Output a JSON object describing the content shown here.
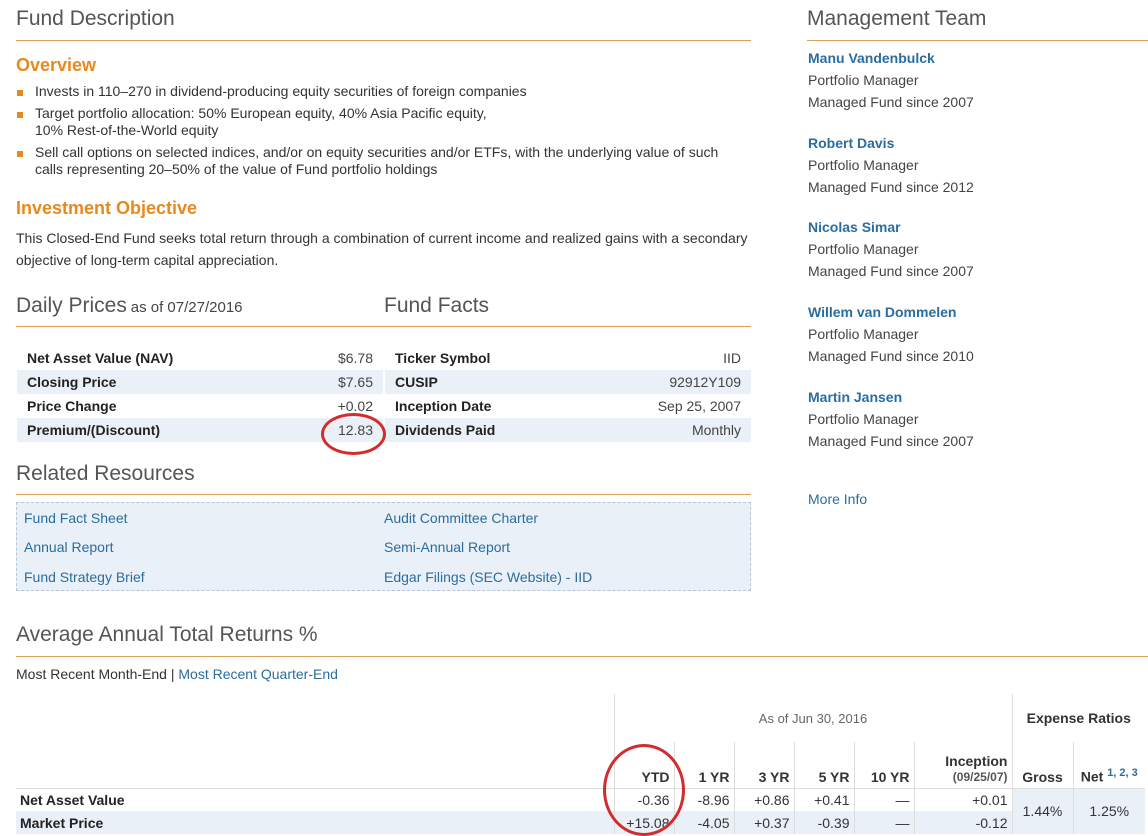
{
  "fund_description": {
    "title": "Fund Description",
    "overview_title": "Overview",
    "bullets": [
      {
        "line1": "Invests in 110–270 in dividend-producing equity securities of foreign companies",
        "line2": ""
      },
      {
        "line1": "Target portfolio allocation: 50% European equity, 40% Asia Pacific equity,",
        "line2": "10% Rest-of-the-World equity"
      },
      {
        "line1": "Sell call options on selected indices, and/or on equity securities and/or ETFs, with the underlying value of such",
        "line2": "calls representing 20–50% of the value of Fund portfolio holdings"
      }
    ],
    "objective_title": "Investment Objective",
    "objective_text": "This Closed-End Fund seeks total return through a combination of current income and realized gains with a secondary objective of long-term capital appreciation."
  },
  "daily_prices": {
    "title": "Daily Prices",
    "as_of": "as of 07/27/2016",
    "rows": [
      {
        "label": "Net Asset Value (NAV)",
        "value": "$6.78"
      },
      {
        "label": "Closing Price",
        "value": "$7.65"
      },
      {
        "label": "Price Change",
        "value": "+0.02"
      },
      {
        "label": "Premium/(Discount)",
        "value": "12.83"
      }
    ]
  },
  "fund_facts": {
    "title": "Fund Facts",
    "rows": [
      {
        "label": "Ticker Symbol",
        "value": "IID"
      },
      {
        "label": "CUSIP",
        "value": "92912Y109"
      },
      {
        "label": "Inception Date",
        "value": "Sep 25, 2007"
      },
      {
        "label": "Dividends Paid",
        "value": "Monthly"
      }
    ]
  },
  "related_resources": {
    "title": "Related Resources",
    "links": [
      "Fund Fact Sheet",
      "Audit Committee Charter",
      "Annual Report",
      "Semi-Annual Report",
      "Fund Strategy Brief",
      "Edgar Filings (SEC Website) - IID"
    ]
  },
  "management": {
    "title": "Management Team",
    "managers": [
      {
        "name": "Manu Vandenbulck",
        "role": "Portfolio Manager",
        "since": "Managed Fund since 2007"
      },
      {
        "name": "Robert Davis",
        "role": "Portfolio Manager",
        "since": "Managed Fund since 2012"
      },
      {
        "name": "Nicolas Simar",
        "role": "Portfolio Manager",
        "since": "Managed Fund since 2007"
      },
      {
        "name": "Willem van Dommelen",
        "role": "Portfolio Manager",
        "since": "Managed Fund since 2010"
      },
      {
        "name": "Martin Jansen",
        "role": "Portfolio Manager",
        "since": "Managed Fund since 2007"
      }
    ],
    "more_info": "More Info"
  },
  "returns": {
    "title": "Average Annual Total Returns %",
    "toggle_month": "Most Recent Month-End",
    "separator": "|",
    "toggle_quarter": "Most Recent Quarter-End",
    "as_of": "As of Jun 30, 2016",
    "expense_title": "Expense Ratios",
    "headers": [
      "YTD",
      "1 YR",
      "3 YR",
      "5 YR",
      "10 YR"
    ],
    "inception_label": "Inception",
    "inception_date": "(09/25/07)",
    "gross_label": "Gross",
    "net_label": "Net",
    "net_footnotes": "1, 2, 3",
    "rows": [
      {
        "label": "Net Asset Value",
        "values": [
          "-0.36",
          "-8.96",
          "+0.86",
          "+0.41",
          "—",
          "+0.01"
        ]
      },
      {
        "label": "Market Price",
        "values": [
          "+15.08",
          "-4.05",
          "+0.37",
          "-0.39",
          "—",
          "-0.12"
        ]
      }
    ],
    "gross_value": "1.44%",
    "net_value": "1.25%"
  },
  "colors": {
    "accent_orange": "#e8891c",
    "link_blue": "#2b6d9e",
    "annotation_red": "#d42c2c"
  }
}
